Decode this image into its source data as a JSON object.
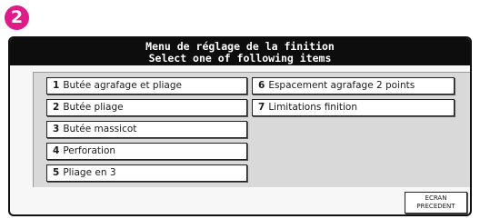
{
  "step_badge": "2",
  "header": {
    "title_line1": "Menu de réglage de la finition",
    "title_line2": "Select one of following items"
  },
  "menu_left": [
    {
      "num": "1",
      "label": "Butée agrafage et pliage"
    },
    {
      "num": "2",
      "label": "Butée pliage"
    },
    {
      "num": "3",
      "label": "Butée massicot"
    },
    {
      "num": "4",
      "label": "Perforation"
    },
    {
      "num": "5",
      "label": "Pliage en 3"
    }
  ],
  "menu_right": [
    {
      "num": "6",
      "label": "Espacement agrafage 2 points"
    },
    {
      "num": "7",
      "label": "Limitations finition"
    }
  ],
  "footer": {
    "back_line1": "ECRAN",
    "back_line2": "PRECEDENT"
  },
  "colors": {
    "badge": "#e2198b",
    "title_bar": "#0d0d0d",
    "panel": "#d9d9d9"
  }
}
